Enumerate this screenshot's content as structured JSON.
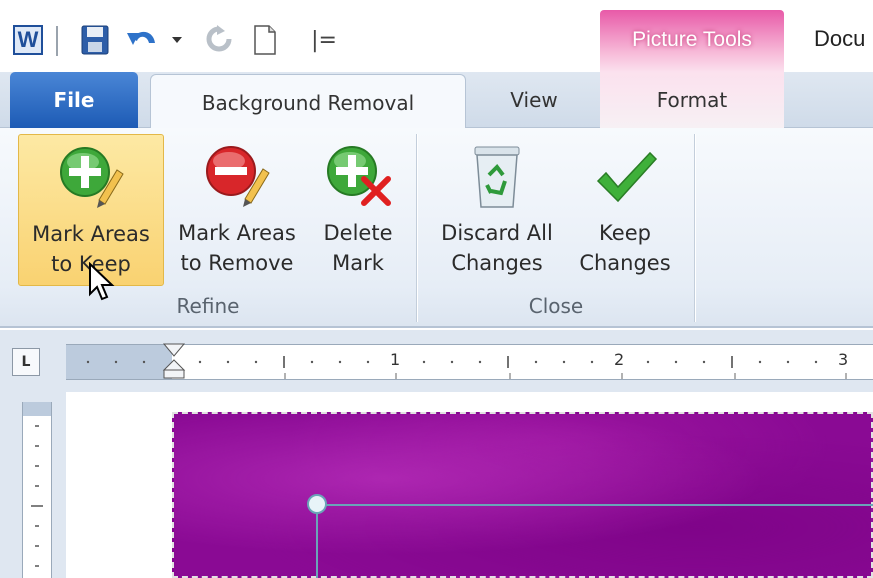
{
  "qat": {
    "more_glyph": "|="
  },
  "contextual": {
    "label": "Picture Tools"
  },
  "document": {
    "title": "Docu"
  },
  "tabs": {
    "file": "File",
    "background_removal": "Background Removal",
    "view": "View",
    "format": "Format"
  },
  "ribbon": {
    "refine": {
      "label": "Refine",
      "mark_keep": {
        "line1": "Mark Areas",
        "line2": "to Keep"
      },
      "mark_remove": {
        "line1": "Mark Areas",
        "line2": "to Remove"
      },
      "delete_mark": {
        "line1": "Delete",
        "line2": "Mark"
      }
    },
    "close": {
      "label": "Close",
      "discard": {
        "line1": "Discard All",
        "line2": "Changes"
      },
      "keep": {
        "line1": "Keep",
        "line2": "Changes"
      }
    }
  },
  "ruler": {
    "tab_selector": "L",
    "numbers": [
      "1",
      "2",
      "3"
    ]
  },
  "icons": {
    "word": "word-app-icon",
    "save": "floppy-disk-icon",
    "undo": "undo-arrow-icon",
    "redo": "redo-arrow-icon",
    "new": "new-document-icon",
    "mark_keep": "green-plus-pencil-icon",
    "mark_remove": "red-minus-pencil-icon",
    "delete_mark": "green-plus-red-x-icon",
    "discard": "recycle-bin-icon",
    "keep": "green-checkmark-icon"
  },
  "colors": {
    "file_tab": "#1d5bb5",
    "picture_tools": "#e85aa8",
    "highlight": "#f9d271",
    "picture_bg": "#8a0a94"
  }
}
